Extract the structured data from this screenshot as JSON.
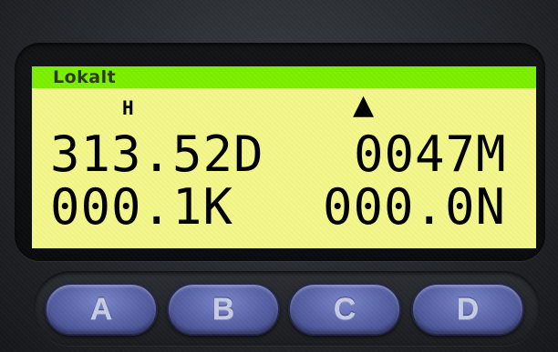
{
  "display": {
    "title": "Lokalt",
    "indicator_letter": "H",
    "indicator_symbol": "▲",
    "rows": [
      {
        "left": "313.52D",
        "right": "0047M"
      },
      {
        "left": "000.1K",
        "right": "000.0N"
      }
    ]
  },
  "buttons": [
    {
      "label": "A"
    },
    {
      "label": "B"
    },
    {
      "label": "C"
    },
    {
      "label": "D"
    }
  ],
  "colors": {
    "lcd_background": "#f4f78a",
    "lcd_header": "#7cf000",
    "button": "#5964a8"
  }
}
